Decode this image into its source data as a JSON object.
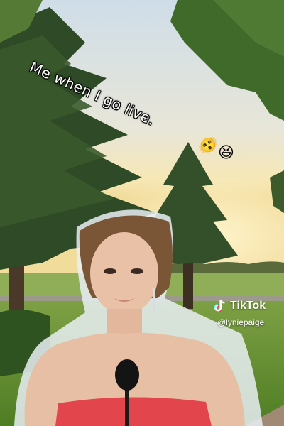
{
  "caption": "Me when I go live.",
  "emojis": [
    "🫨",
    "😆"
  ],
  "watermark": {
    "brand": "TikTok",
    "handle": "@lyniepaige"
  },
  "colors": {
    "sky_top": "#cfe0ea",
    "sky_horizon": "#f5e7b8",
    "grass": "#5f8f2f",
    "dress": "#e2454b"
  }
}
